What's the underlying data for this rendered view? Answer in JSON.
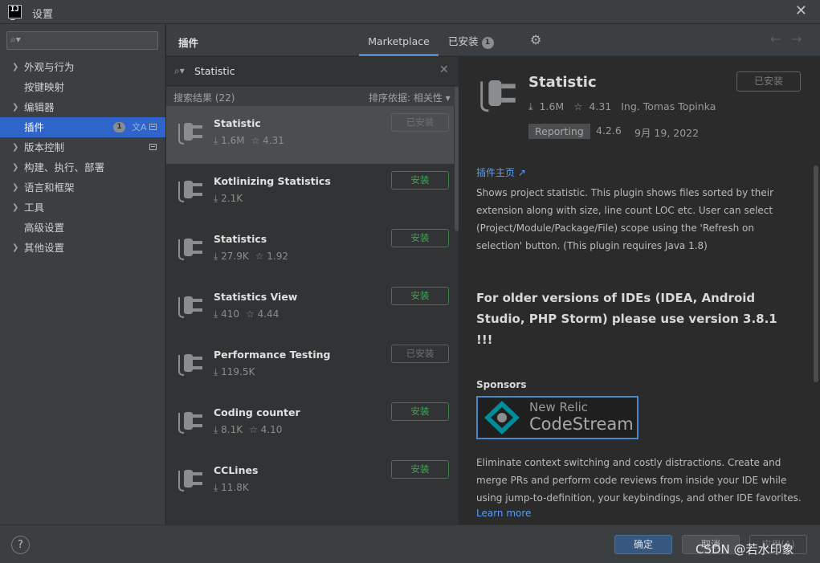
{
  "window": {
    "title": "设置"
  },
  "sidebar": {
    "search_placeholder": "",
    "items": [
      {
        "label": "外观与行为",
        "chevron": true
      },
      {
        "label": "按键映射",
        "chevron": false
      },
      {
        "label": "编辑器",
        "chevron": true
      },
      {
        "label": "插件",
        "chevron": false,
        "selected": true,
        "badge": "1"
      },
      {
        "label": "版本控制",
        "chevron": true
      },
      {
        "label": "构建、执行、部署",
        "chevron": true
      },
      {
        "label": "语言和框架",
        "chevron": true
      },
      {
        "label": "工具",
        "chevron": true
      },
      {
        "label": "高级设置",
        "chevron": false
      },
      {
        "label": "其他设置",
        "chevron": true
      }
    ]
  },
  "header": {
    "title": "插件",
    "tabs": {
      "marketplace": "Marketplace",
      "installed": "已安装",
      "installed_badge": "1"
    }
  },
  "search": {
    "value": "Statistic"
  },
  "results": {
    "count_label": "搜索结果 (22)",
    "sort_label": "排序依据: 相关性"
  },
  "plugins": [
    {
      "name": "Statistic",
      "downloads": "1.6M",
      "rating": "4.31",
      "button": "已安装"
    },
    {
      "name": "Kotlinizing Statistics",
      "downloads": "2.1K",
      "rating": "",
      "button": "安装"
    },
    {
      "name": "Statistics",
      "downloads": "27.9K",
      "rating": "1.92",
      "button": "安装"
    },
    {
      "name": "Statistics View",
      "downloads": "410",
      "rating": "4.44",
      "button": "安装"
    },
    {
      "name": "Performance Testing",
      "downloads": "119.5K",
      "rating": "",
      "button": "已安装"
    },
    {
      "name": "Coding counter",
      "downloads": "8.1K",
      "rating": "4.10",
      "button": "安装"
    },
    {
      "name": "CCLines",
      "downloads": "11.8K",
      "rating": "",
      "button": "安装"
    }
  ],
  "detail": {
    "title": "Statistic",
    "installed_button": "已安装",
    "downloads": "1.6M",
    "rating": "4.31",
    "author": "Ing. Tomas Topinka",
    "tag": "Reporting",
    "version": "4.2.6",
    "date": "9月 19, 2022",
    "homepage_link": "插件主页",
    "description": "Shows project statistic. This plugin shows files sorted by their extension along with size, line count LOC etc. User can select (Project/Module/Package/File) scope using the 'Refresh on selection' button. (This plugin requires Java 1.8)",
    "bold_note": "For older versions of IDEs (IDEA, Android Studio, PHP Storm) please use version 3.8.1 !!!",
    "sponsors_heading": "Sponsors",
    "sponsor_logo_line1": "New Relic",
    "sponsor_logo_line2": "CodeStream",
    "sponsor_description": "Eliminate context switching and costly distractions. Create and merge PRs and perform code reviews from inside your IDE while using jump-to-definition, your keybindings, and other IDE favorites.",
    "learn_more": "Learn more"
  },
  "footer": {
    "help": "?",
    "ok": "确定",
    "cancel": "取消",
    "apply": "应用(A)",
    "watermark": "CSDN @若水印象"
  },
  "colors": {
    "accent": "#2f65ca",
    "install_green": "#4a9e5c",
    "link_blue": "#589df6",
    "codestream_teal": "#008c99"
  }
}
